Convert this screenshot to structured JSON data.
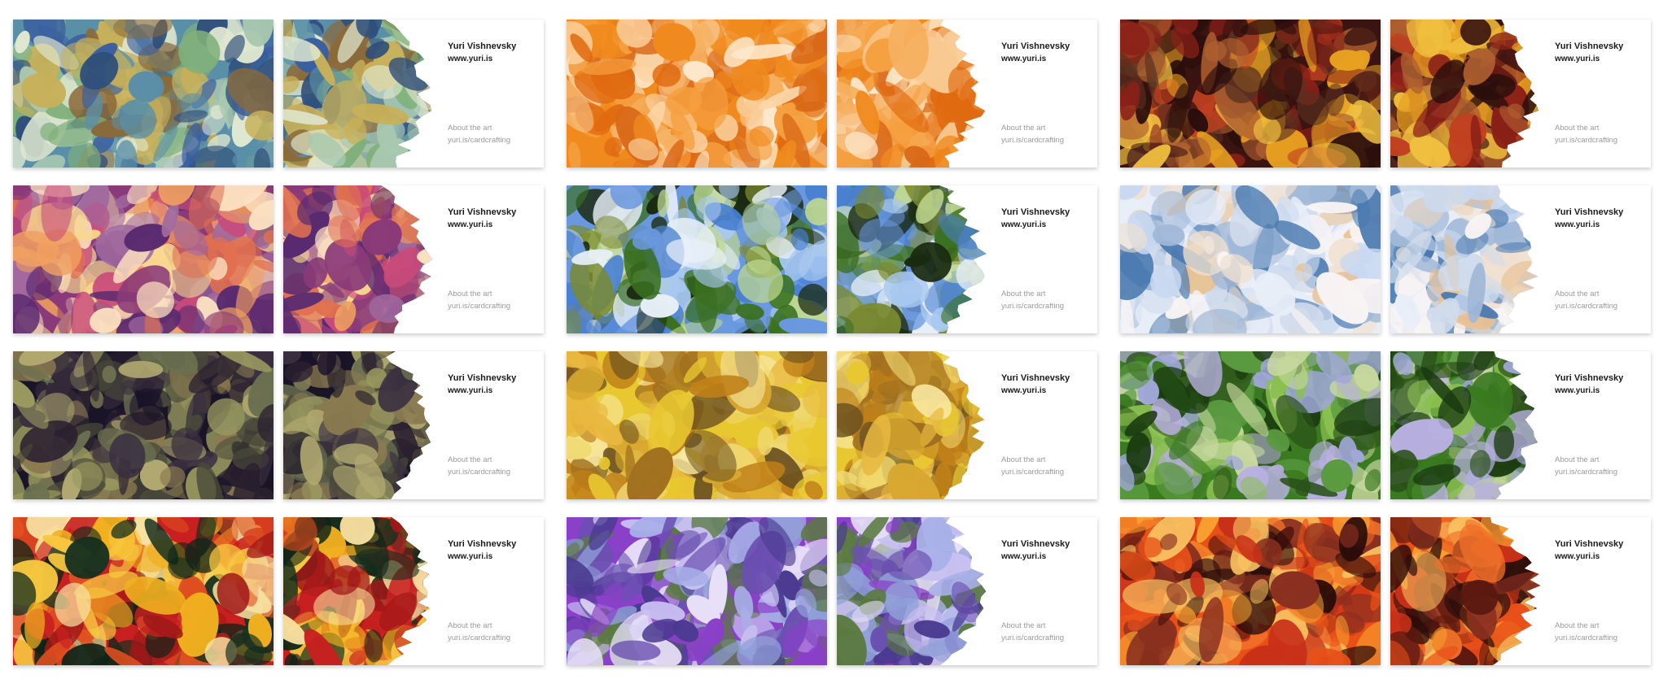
{
  "card_text": {
    "name": "Yuri Vishnevsky",
    "website": "www.yuri.is",
    "about_label": "About the art",
    "about_link": "yuri.is/cardcrafting"
  },
  "designs": [
    {
      "id": "teal-blue-burst",
      "colors": [
        "#5a8fa8",
        "#3a5fa0",
        "#7fb07a",
        "#c8b05a",
        "#2f4f7a",
        "#a8c8b0",
        "#8a6a3a",
        "#e0e8d0"
      ]
    },
    {
      "id": "orange-cream",
      "colors": [
        "#f08a1e",
        "#f5b060",
        "#fbd6a8",
        "#e06a10",
        "#f8c890",
        "#d86818",
        "#fde8cc",
        "#f5a040"
      ]
    },
    {
      "id": "dark-red-yellow",
      "colors": [
        "#3a1410",
        "#8a2018",
        "#e8a020",
        "#5a3020",
        "#c04020",
        "#f0c040",
        "#2a0e0c",
        "#b06030"
      ]
    },
    {
      "id": "magenta-sunset",
      "colors": [
        "#8a3a78",
        "#c84a7a",
        "#f0a060",
        "#5a2a70",
        "#f8d890",
        "#e07050",
        "#a06aa0",
        "#fbe0c0"
      ]
    },
    {
      "id": "sky-forest",
      "colors": [
        "#6a98e0",
        "#3a7020",
        "#a8c8f0",
        "#7a8a30",
        "#1a2a10",
        "#c0d890",
        "#4a80d0",
        "#e8f0f8"
      ]
    },
    {
      "id": "pale-sky",
      "colors": [
        "#e8eef8",
        "#c8d8f0",
        "#f0e0d0",
        "#4a7ab0",
        "#f8f4f4",
        "#a0b8d8",
        "#e8c090",
        "#d0dcec"
      ]
    },
    {
      "id": "olive-midnight",
      "colors": [
        "#1a1428",
        "#6a7050",
        "#3a3040",
        "#9a9a60",
        "#2a2030",
        "#8a7a50",
        "#4a4a3a",
        "#b0a870"
      ]
    },
    {
      "id": "golden-yellow",
      "colors": [
        "#e8c830",
        "#f0d870",
        "#c08018",
        "#a07020",
        "#f8e8a0",
        "#d8a830",
        "#6a5020",
        "#e8b840"
      ]
    },
    {
      "id": "green-lilac",
      "colors": [
        "#3a7a20",
        "#8ac050",
        "#a0a8d8",
        "#1a3a10",
        "#c8d8a0",
        "#5a9a40",
        "#b8b0e0",
        "#2a5018"
      ]
    },
    {
      "id": "red-amber",
      "colors": [
        "#c82020",
        "#f0b020",
        "#18301e",
        "#e05020",
        "#f8e0a0",
        "#a01818",
        "#f8c840",
        "#0e2418"
      ]
    },
    {
      "id": "violet-periwinkle",
      "colors": [
        "#8a40c8",
        "#a8b0e8",
        "#5a7a40",
        "#c8c0f0",
        "#6a50b0",
        "#90a0d8",
        "#e8e0f8",
        "#4a3a90"
      ]
    },
    {
      "id": "fire-orange",
      "colors": [
        "#e85018",
        "#f8a030",
        "#5a1810",
        "#f07028",
        "#2a0c0a",
        "#c83018",
        "#f8c060",
        "#8a3020"
      ]
    }
  ]
}
